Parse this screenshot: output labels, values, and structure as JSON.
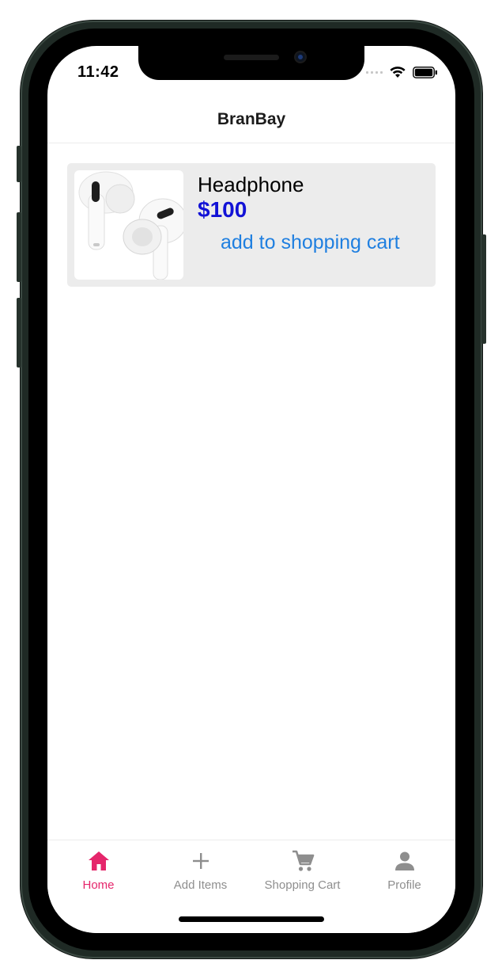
{
  "status_bar": {
    "time": "11:42"
  },
  "header": {
    "title": "BranBay"
  },
  "products": [
    {
      "name": "Headphone",
      "price": "$100",
      "action_label": "add to shopping cart",
      "image_icon": "earbuds-image"
    }
  ],
  "tabs": [
    {
      "label": "Home",
      "icon": "home-icon",
      "active": true
    },
    {
      "label": "Add Items",
      "icon": "plus-icon",
      "active": false
    },
    {
      "label": "Shopping Cart",
      "icon": "cart-icon",
      "active": false
    },
    {
      "label": "Profile",
      "icon": "person-icon",
      "active": false
    }
  ],
  "colors": {
    "active_tab": "#e5266b",
    "inactive_tab": "#8e8e8e",
    "price": "#1212d6",
    "link": "#1f7fe0",
    "card_background": "#ececec"
  }
}
